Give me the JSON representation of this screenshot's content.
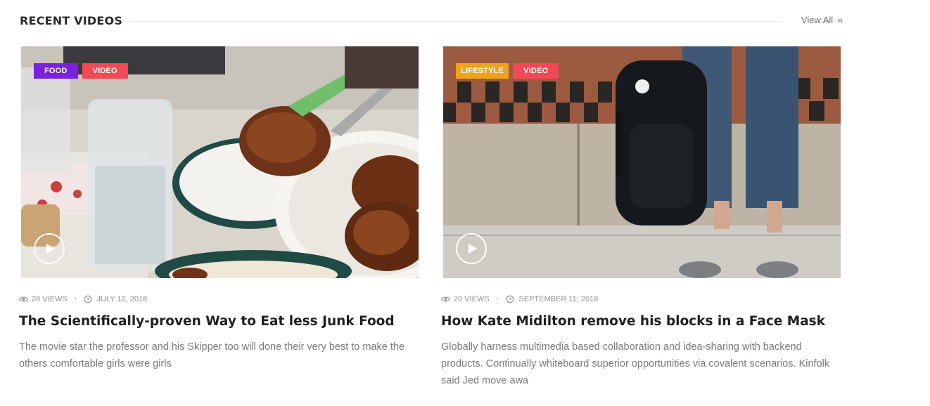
{
  "section": {
    "title": "RECENT VIDEOS",
    "view_all": "View All"
  },
  "colors": {
    "food": "#7a22e0",
    "video": "#f44856",
    "lifestyle": "#f0a31a"
  },
  "videos": [
    {
      "tags": [
        {
          "label": "FOOD",
          "color": "#7a22e0"
        },
        {
          "label": "VIDEO",
          "color": "#f44856"
        }
      ],
      "views": "28 VIEWS",
      "date": "JULY 12, 2018",
      "title": "The Scientifically-proven Way to Eat less Junk Food",
      "excerpt": "The movie star the professor and his Skipper too will done their very best to make the others comfortable girls were girls"
    },
    {
      "tags": [
        {
          "label": "LIFESTYLE",
          "color": "#f0a31a"
        },
        {
          "label": "VIDEO",
          "color": "#f44856"
        }
      ],
      "views": "20 VIEWS",
      "date": "SEPTEMBER 11, 2018",
      "title": "How Kate Midilton remove his blocks in a Face Mask",
      "excerpt": "Globally harness multimedia based collaboration and idea-sharing with backend products. Continually whiteboard superior opportunities via covalent scenarios. Kinfolk said Jed move awa"
    }
  ]
}
